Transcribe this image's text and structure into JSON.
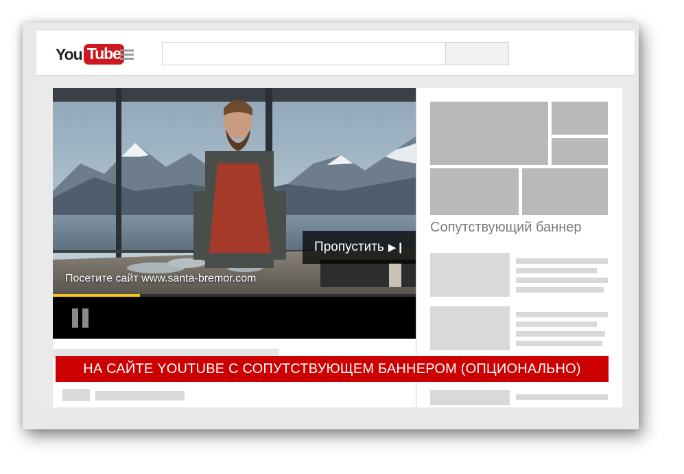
{
  "header": {
    "logo_you": "You",
    "logo_tube": "Tube",
    "search_value": ""
  },
  "video": {
    "skip_label": "Пропустить",
    "skip_icon": "skip-next-icon",
    "visit_text": "Посетите сайт www.santa-bremor.com",
    "progress": 0.24,
    "progress_color": "#f5c518"
  },
  "sidebar": {
    "banner_label": "Сопутствующий баннер"
  },
  "caption": {
    "text": "НА САЙТЕ YOUTUBE С СОПУТСТВУЮЩЕМ БАННЕРОМ (ОПЦИОНАЛЬНО)",
    "color": "#cc0000"
  },
  "colors": {
    "brand_red": "#cc181e",
    "placeholder_dark": "#b9b9b9",
    "placeholder_light": "#d9d9d9"
  }
}
